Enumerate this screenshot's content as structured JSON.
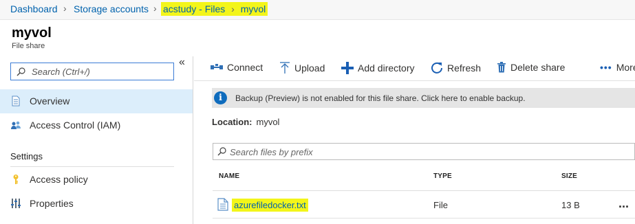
{
  "breadcrumb": {
    "items": [
      "Dashboard",
      "Storage accounts",
      "acstudy - Files",
      "myvol"
    ]
  },
  "header": {
    "title": "myvol",
    "subtitle": "File share"
  },
  "sidebar": {
    "search_placeholder": "Search (Ctrl+/)",
    "collapse_label": "«",
    "items": [
      {
        "label": "Overview",
        "icon": "document-icon",
        "active": true
      },
      {
        "label": "Access Control (IAM)",
        "icon": "users-icon",
        "active": false
      }
    ],
    "section_title": "Settings",
    "settings_items": [
      {
        "label": "Access policy",
        "icon": "key-icon"
      },
      {
        "label": "Properties",
        "icon": "properties-icon"
      }
    ]
  },
  "toolbar": {
    "connect": "Connect",
    "upload": "Upload",
    "add_directory": "Add directory",
    "refresh": "Refresh",
    "delete_share": "Delete share",
    "more": "More"
  },
  "banner": {
    "text": "Backup (Preview) is not enabled for this file share. Click here to enable backup."
  },
  "location": {
    "label": "Location:",
    "value": "myvol"
  },
  "file_search": {
    "placeholder": "Search files by prefix"
  },
  "table": {
    "columns": [
      "NAME",
      "TYPE",
      "SIZE"
    ],
    "rows": [
      {
        "name": "azurefiledocker.txt",
        "type": "File",
        "size": "13 B",
        "more": "..."
      }
    ]
  },
  "colors": {
    "accent": "#0062ad",
    "highlight": "#f3f51a",
    "active_nav": "#dceefb",
    "info": "#0f6cbd"
  }
}
